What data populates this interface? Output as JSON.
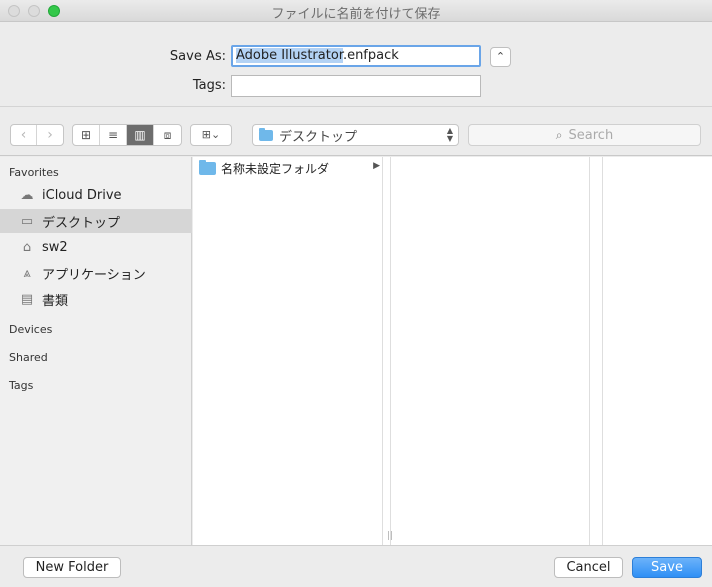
{
  "window": {
    "title": "ファイルに名前を付けて保存"
  },
  "save_as": {
    "label": "Save As:",
    "filename_selected": "Adobe Illustrator",
    "filename_ext": ".enfpack"
  },
  "tags": {
    "label": "Tags:",
    "value": ""
  },
  "toolbar": {
    "back_glyph": "‹",
    "forward_glyph": "›",
    "view_icons_glyph": "⊞",
    "view_list_glyph": "≡",
    "view_columns_glyph": "▥",
    "view_coverflow_glyph": "⧈",
    "arrange_glyph": "⊞⌄",
    "location": "デスクトップ",
    "search_placeholder": "Search"
  },
  "sidebar": {
    "favorites_heading": "Favorites",
    "items": [
      {
        "label": "iCloud Drive",
        "icon": "cloud-icon",
        "glyph": "☁"
      },
      {
        "label": "デスクトップ",
        "icon": "desktop-icon",
        "glyph": "▭"
      },
      {
        "label": "sw2",
        "icon": "home-icon",
        "glyph": "⌂"
      },
      {
        "label": "アプリケーション",
        "icon": "applications-icon",
        "glyph": "⩓"
      },
      {
        "label": "書類",
        "icon": "documents-icon",
        "glyph": "▤"
      }
    ],
    "devices_heading": "Devices",
    "shared_heading": "Shared",
    "tags_heading": "Tags"
  },
  "browser": {
    "column1": [
      {
        "name": "名称未設定フォルダ",
        "type": "folder"
      }
    ],
    "disclosure_glyph": "▶",
    "grip_glyph": "||"
  },
  "footer": {
    "new_folder": "New Folder",
    "cancel": "Cancel",
    "save": "Save"
  },
  "colors": {
    "accent": "#2f8ff5",
    "selection": "#b3d2f4",
    "folder": "#6fb8ea"
  }
}
